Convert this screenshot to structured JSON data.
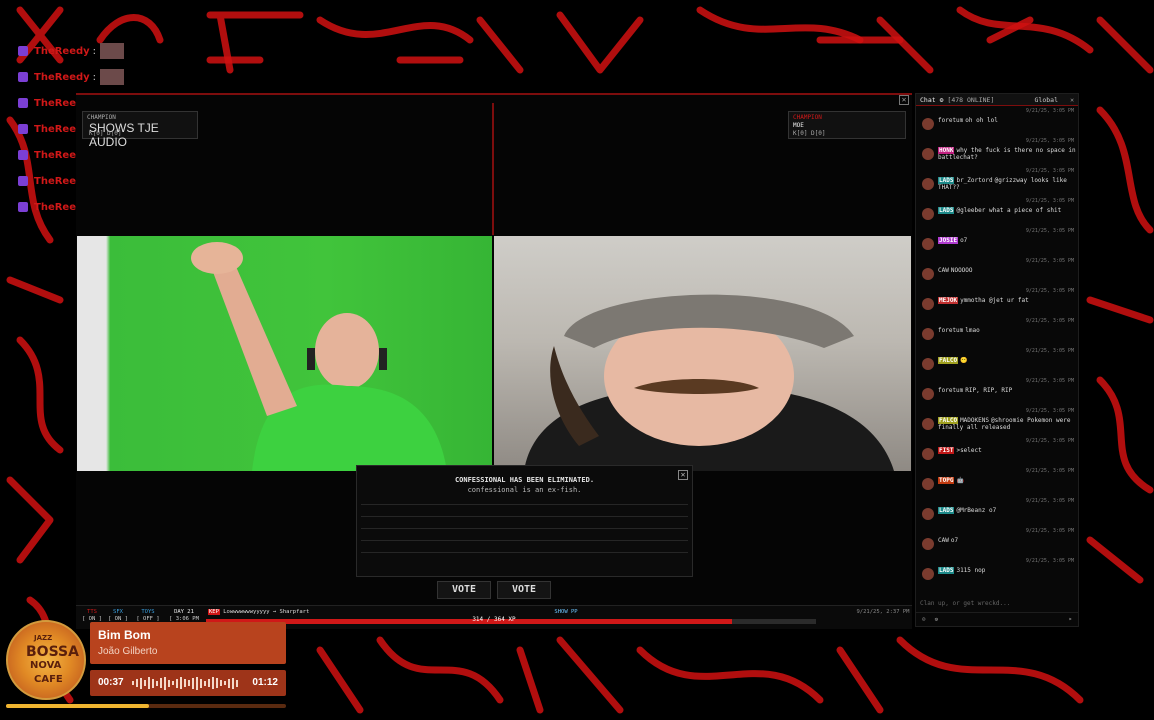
{
  "overlay_chat": {
    "rows": [
      {
        "name": "TheReedy",
        "sep": ":",
        "msg": ""
      },
      {
        "name": "TheReedy",
        "sep": ":",
        "msg": ""
      },
      {
        "name": "TheReedy",
        "sep": ":",
        "msg": ""
      },
      {
        "name": "TheReedy",
        "sep": ":",
        "msg": "?"
      },
      {
        "name": "TheReedy",
        "sep": ":",
        "msg": "?"
      },
      {
        "name": "TheReedy",
        "sep": ":",
        "msg": "?"
      },
      {
        "name": "TheReedy",
        "sep": ":",
        "msg": "?"
      }
    ]
  },
  "left_panel": {
    "small": "CHAMPION",
    "small2": "K[0] D[0]",
    "title": "SHOWS TJE AUDIO"
  },
  "right_panel": {
    "small": "CHAMPION",
    "title": "MOE",
    "stats": "K[0] D[0]"
  },
  "confessional": {
    "line1": "CONFESSIONAL HAS BEEN ELIMINATED.",
    "line2": "confessional is an ex-fish.",
    "close": "✕"
  },
  "votes": [
    "VOTE",
    "VOTE"
  ],
  "statusbar": {
    "items": [
      {
        "label": "TTS",
        "state": "[ ON ]"
      },
      {
        "label": "SFX",
        "state": "[ ON ]"
      },
      {
        "label": "TOYS",
        "state": "[ OFF ]"
      },
      {
        "label": "DAY 21",
        "state": "[ 3:06 PM ]"
      }
    ],
    "ticker_tag": "KEP",
    "ticker": "Lowwwwwwwyyyyy → Sharpfart",
    "center": "SHOW PP",
    "right": "9/21/25, 2:37 PM",
    "xp": "314 / 364 XP",
    "xp_fraction": 0.863
  },
  "chat": {
    "header": "Chat",
    "online": "[478 ONLINE]",
    "scope": "Global",
    "close": "✕",
    "messages": [
      {
        "ts": "9/21/25, 3:05 PM",
        "tag": "",
        "tag_color": "",
        "user": "foretum",
        "text": "oh oh lol"
      },
      {
        "ts": "9/21/25, 3:05 PM",
        "tag": "HONK",
        "tag_color": "#c02080",
        "user": "",
        "text": "why the fuck is there no space in battlechat?"
      },
      {
        "ts": "9/21/25, 3:05 PM",
        "tag": "LADS",
        "tag_color": "#1e8a8a",
        "user": "br_Zortord",
        "text": "@grizzway looks like THAT??"
      },
      {
        "ts": "9/21/25, 3:05 PM",
        "tag": "LADS",
        "tag_color": "#1e8a8a",
        "user": "",
        "text": "@gleeber what a piece of shit"
      },
      {
        "ts": "9/21/25, 3:05 PM",
        "tag": "JOSIE",
        "tag_color": "#b03cd0",
        "user": "",
        "text": "o7"
      },
      {
        "ts": "9/21/25, 3:05 PM",
        "tag": "",
        "tag_color": "",
        "user": "CAW",
        "text": "NOOOOO"
      },
      {
        "ts": "9/21/25, 3:05 PM",
        "tag": "MEJOK",
        "tag_color": "#c03030",
        "user": "",
        "text": "ymmotha @jet ur fat"
      },
      {
        "ts": "9/21/25, 3:05 PM",
        "tag": "",
        "tag_color": "",
        "user": "foretum",
        "text": "lmao"
      },
      {
        "ts": "9/21/25, 3:05 PM",
        "tag": "FALCO",
        "tag_color": "#a0a020",
        "user": "",
        "text": "😶"
      },
      {
        "ts": "9/21/25, 3:05 PM",
        "tag": "",
        "tag_color": "",
        "user": "foretum",
        "text": "RIP, RIP, RIP"
      },
      {
        "ts": "9/21/25, 3:05 PM",
        "tag": "FALCO",
        "tag_color": "#a0a020",
        "user": "MADOKENS",
        "text": "@shroomie Pokemon were finally all released"
      },
      {
        "ts": "9/21/25, 3:05 PM",
        "tag": "FIST",
        "tag_color": "#c01818",
        "user": "",
        "text": ">select"
      },
      {
        "ts": "9/21/25, 3:05 PM",
        "tag": "TOPG",
        "tag_color": "#c03a10",
        "user": "",
        "text": "🤖"
      },
      {
        "ts": "9/21/25, 3:05 PM",
        "tag": "LADS",
        "tag_color": "#1e8a8a",
        "user": "",
        "text": "@MrBeanz o7"
      },
      {
        "ts": "9/21/25, 3:05 PM",
        "tag": "",
        "tag_color": "",
        "user": "CAW",
        "text": "o7"
      },
      {
        "ts": "9/21/25, 3:05 PM",
        "tag": "LADS",
        "tag_color": "#1e8a8a",
        "user": "",
        "text": "3115 nop"
      }
    ],
    "input_placeholder": "Clan up, or get wreckd..."
  },
  "music": {
    "title": "Bim Bom",
    "artist": "João Gilberto",
    "elapsed": "00:37",
    "total": "01:12",
    "progress": 0.51,
    "album_text": [
      "JAZZ",
      "BOSSA",
      "NOVA",
      "CAFE"
    ]
  }
}
